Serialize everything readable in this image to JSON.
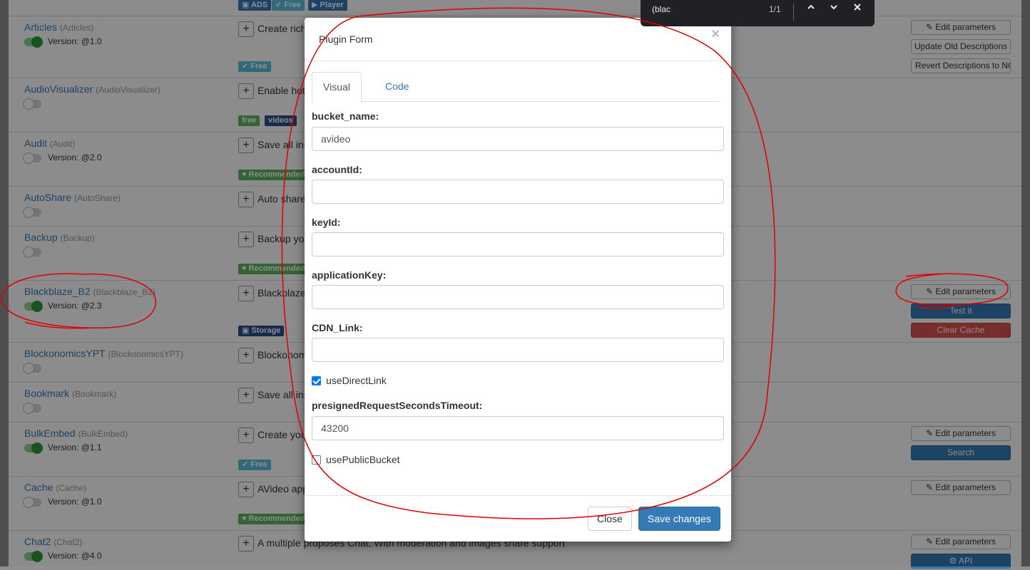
{
  "plugins": [
    {
      "name": "Articles",
      "id": "(Articles)",
      "enabled": true,
      "version": "Version: @1.0",
      "desc": "Create rich",
      "tags": [
        {
          "label": "✔ Free",
          "color": "cyan"
        }
      ],
      "buttons": [
        {
          "label": "✎ Edit parameters",
          "style": "default"
        },
        {
          "label": "Update Old Descriptions",
          "style": "default"
        },
        {
          "label": "Revert Descriptions to NO",
          "style": "default"
        }
      ]
    },
    {
      "name": "AudioVisualizer",
      "id": "(AudioVisualizer)",
      "enabled": false,
      "version": "",
      "desc": "Enable hot",
      "tags": [
        {
          "label": "free",
          "color": "green"
        },
        {
          "label": "videos",
          "color": "navy"
        }
      ],
      "buttons": []
    },
    {
      "name": "Audit",
      "id": "(Audit)",
      "enabled": false,
      "version": "Version: @2.0",
      "desc": "Save all ins",
      "tags": [
        {
          "label": "♥ Recommended",
          "color": "green"
        }
      ],
      "buttons": []
    },
    {
      "name": "AutoShare",
      "id": "(AutoShare)",
      "enabled": false,
      "version": "",
      "desc": "Auto share",
      "tags": [],
      "buttons": []
    },
    {
      "name": "Backup",
      "id": "(Backup)",
      "enabled": false,
      "version": "",
      "desc": "Backup yo",
      "tags": [
        {
          "label": "♥ Recommended",
          "color": "green"
        }
      ],
      "buttons": []
    },
    {
      "name": "Blackblaze_B2",
      "id": "(Blackblaze_B2)",
      "enabled": true,
      "version": "Version: @2.3",
      "desc": "Blackblaze",
      "tags": [
        {
          "label": "▣ Storage",
          "color": "navy"
        }
      ],
      "buttons": [
        {
          "label": "✎ Edit parameters",
          "style": "default"
        },
        {
          "label": "Test it",
          "style": "primary"
        },
        {
          "label": "Clear Cache",
          "style": "danger"
        }
      ]
    },
    {
      "name": "BlockonomicsYPT",
      "id": "(BlockonomicsYPT)",
      "enabled": false,
      "version": "",
      "desc": "Blockonom",
      "tags": [],
      "buttons": []
    },
    {
      "name": "Bookmark",
      "id": "(Bookmark)",
      "enabled": false,
      "version": "",
      "desc": "Save all ins",
      "tags": [],
      "buttons": []
    },
    {
      "name": "BulkEmbed",
      "id": "(BulkEmbed)",
      "enabled": true,
      "version": "Version: @1.1",
      "desc": "Create you",
      "tags": [
        {
          "label": "✔ Free",
          "color": "cyan"
        }
      ],
      "buttons": [
        {
          "label": "✎ Edit parameters",
          "style": "default"
        },
        {
          "label": "Search",
          "style": "primary"
        }
      ]
    },
    {
      "name": "Cache",
      "id": "(Cache)",
      "enabled": false,
      "version": "Version: @1.0",
      "desc": "AVideo app",
      "tags": [
        {
          "label": "♥ Recommended",
          "color": "green"
        }
      ],
      "buttons": [
        {
          "label": "✎ Edit parameters",
          "style": "default"
        }
      ]
    },
    {
      "name": "Chat2",
      "id": "(Chat2)",
      "enabled": true,
      "version": "Version: @4.0",
      "desc": "A multiple proposes Chat, With moderation and images share support",
      "tags": [],
      "buttons": [
        {
          "label": "✎ Edit parameters",
          "style": "default"
        },
        {
          "label": "⚙ API",
          "style": "primary"
        }
      ]
    }
  ],
  "top_tags": [
    {
      "label": "▣ ADS",
      "color": "blue"
    },
    {
      "label": "✔ Free",
      "color": "cyan"
    },
    {
      "label": "▶ Player",
      "color": "blue"
    }
  ],
  "find_bar": {
    "query": "(blac",
    "count": "1/1"
  },
  "modal": {
    "title": "Plugin Form",
    "close_glyph": "×",
    "tabs": [
      {
        "label": "Visual",
        "active": true
      },
      {
        "label": "Code",
        "active": false
      }
    ],
    "fields": [
      {
        "label": "bucket_name:",
        "value": "avideo"
      },
      {
        "label": "accountId:",
        "value": ""
      },
      {
        "label": "keyId:",
        "value": ""
      },
      {
        "label": "applicationKey:",
        "value": ""
      },
      {
        "label": "CDN_Link:",
        "value": ""
      }
    ],
    "checkbox1": {
      "label": "useDirectLink",
      "checked": true
    },
    "timeout_field": {
      "label": "presignedRequestSecondsTimeout:",
      "value": "43200"
    },
    "checkbox2": {
      "label": "usePublicBucket",
      "checked": false
    },
    "close_label": "Close",
    "save_label": "Save changes"
  },
  "colors": {
    "annotation": "#e00000",
    "primary": "#337ab7",
    "danger": "#d9534f",
    "success": "#5cb85c"
  }
}
